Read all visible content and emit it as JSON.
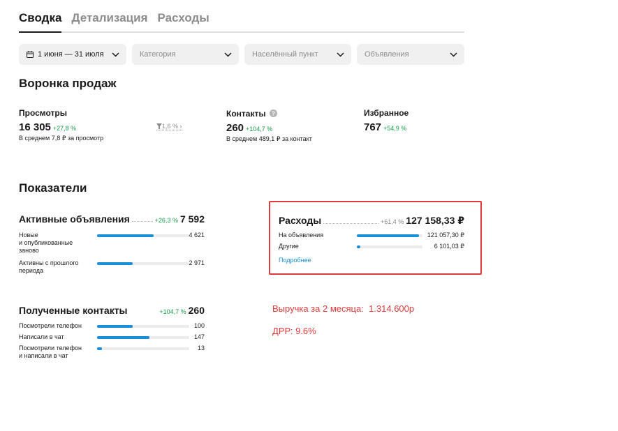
{
  "tabs": [
    {
      "label": "Сводка",
      "active": true
    },
    {
      "label": "Детализация",
      "active": false
    },
    {
      "label": "Расходы",
      "active": false
    }
  ],
  "filters": {
    "date": "1 июня — 31 июля",
    "category_placeholder": "Категория",
    "locality_placeholder": "Населённый пункт",
    "ads_placeholder": "Объявления"
  },
  "funnel": {
    "title": "Воронка продаж",
    "views": {
      "label": "Просмотры",
      "value": "16 305",
      "delta": "+27,8 %",
      "sub": "В среднем 7,8 ₽ за просмотр"
    },
    "conversion": "1,6 %",
    "contacts": {
      "label": "Контакты",
      "value": "260",
      "delta": "+104,7 %",
      "sub": "В среднем 489,1 ₽ за контакт"
    },
    "favorites": {
      "label": "Избранное",
      "value": "767",
      "delta": "+54,9 %"
    }
  },
  "indicators": {
    "title": "Показатели",
    "active_ads": {
      "title": "Активные объявления",
      "delta": "+26,3 %",
      "total": "7 592",
      "rows": [
        {
          "label": "Новые\nи опубликованные\nзаново",
          "value": "4 621",
          "share": 0.61
        },
        {
          "label": "Активны с прошлого\nпериода",
          "value": "2 971",
          "share": 0.39
        }
      ]
    },
    "contacts": {
      "title": "Полученные контакты",
      "delta": "+104,7 %",
      "total": "260",
      "rows": [
        {
          "label": "Посмотрели телефон",
          "value": "100",
          "share": 0.385
        },
        {
          "label": "Написали в чат",
          "value": "147",
          "share": 0.565
        },
        {
          "label": "Посмотрели телефон\nи написали в чат",
          "value": "13",
          "share": 0.05
        }
      ]
    },
    "expenses": {
      "title": "Расходы",
      "delta": "+61,4 %",
      "total": "127 158,33 ₽",
      "rows": [
        {
          "label": "На объявления",
          "value": "121 057,30 ₽",
          "share": 0.952
        },
        {
          "label": "Другие",
          "value": "6 101,03 ₽",
          "share": 0.048
        }
      ],
      "link": "Подробнее"
    }
  },
  "notes": {
    "revenue": "Выручка за 2 месяца:  1.314.600р",
    "drr": "ДРР: 9.6%"
  },
  "colors": {
    "accent": "#1a8fd9",
    "positive": "#1a9c4a",
    "annotation": "#e03a3a"
  }
}
